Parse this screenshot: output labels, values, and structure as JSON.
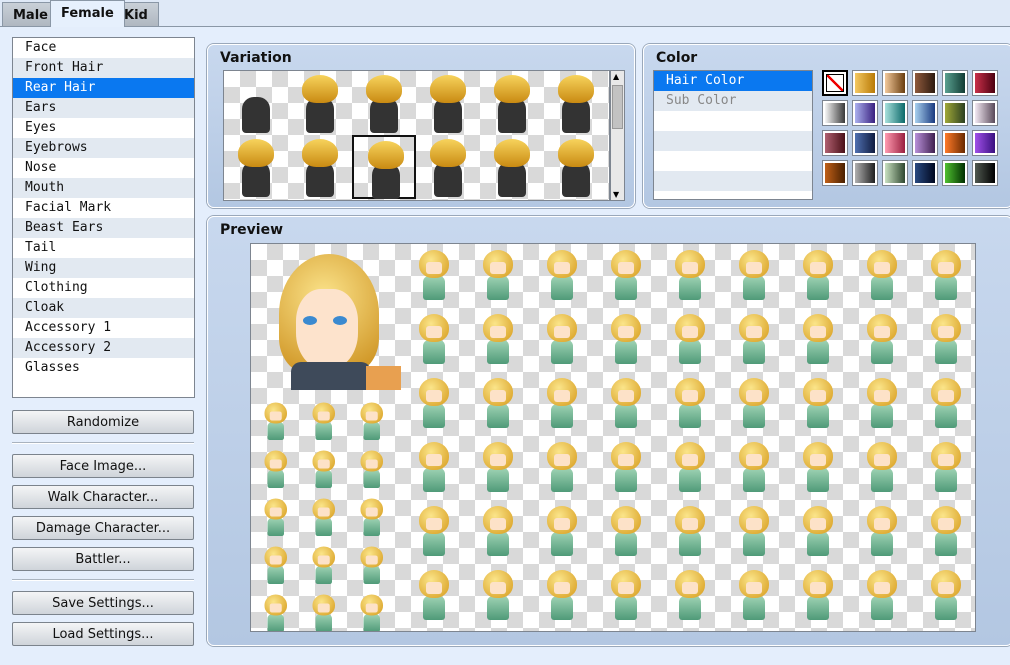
{
  "tabs": [
    "Male",
    "Female",
    "Kid"
  ],
  "active_tab": "Female",
  "parts": [
    "Face",
    "Front Hair",
    "Rear Hair",
    "Ears",
    "Eyes",
    "Eyebrows",
    "Nose",
    "Mouth",
    "Facial Mark",
    "Beast Ears",
    "Tail",
    "Wing",
    "Clothing",
    "Cloak",
    "Accessory 1",
    "Accessory 2",
    "Glasses"
  ],
  "selected_part": "Rear Hair",
  "buttons": {
    "randomize": "Randomize",
    "face": "Face Image...",
    "walk": "Walk Character...",
    "damage": "Damage Character...",
    "battler": "Battler...",
    "save": "Save Settings...",
    "load": "Load Settings..."
  },
  "variation": {
    "title": "Variation",
    "selected_index": 8,
    "count": 12
  },
  "color": {
    "title": "Color",
    "items": [
      "Hair Color",
      "Sub Color"
    ],
    "selected": "Hair Color",
    "swatches": [
      [
        "none",
        "#f3c862|#b97a06",
        "#f2c89a|#6a3e10",
        "#8f5a3c|#2d1a10",
        "#5aa090|#123c34",
        "#c8304a|#4c0010"
      ],
      [
        "#f5f5f5|#3a3a3a",
        "#aab0ee|#3a2080",
        "#a8e0dc|#0c6a6a",
        "#a8d0ee|#1a3a80",
        "#a0a838|#2c4020",
        "#f2e8f2|#5a4a5a"
      ],
      [
        "#b06070|#4a1018",
        "#5070b0|#101c40",
        "#ff9ab0|#9a2040",
        "#b890d8|#402050",
        "#ff7a28|#6a2a00",
        "#a050e8|#3a1080"
      ],
      [
        "#c06018|#4a2000",
        "#b0b0b0|#202020",
        "#c8e0c0|#304830",
        "#2a4a80|#000820",
        "#50c030|#003000",
        "#505850|#000000"
      ]
    ]
  },
  "preview": {
    "title": "Preview"
  }
}
